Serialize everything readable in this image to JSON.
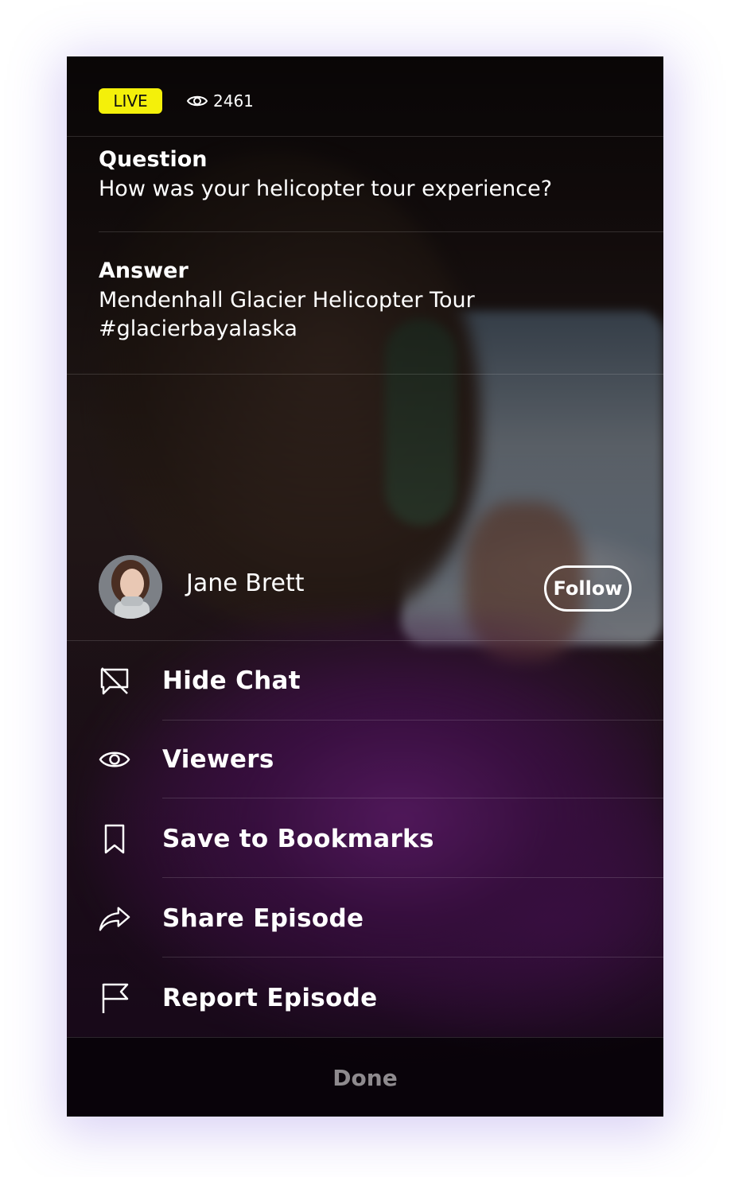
{
  "status": {
    "live_label": "LIVE",
    "viewer_count": "2461"
  },
  "question": {
    "label": "Question",
    "text": "How was your helicopter tour experience?"
  },
  "answer": {
    "label": "Answer",
    "text_line1": "Mendenhall Glacier Helicopter Tour",
    "text_line2": "#glacierbayalaska"
  },
  "host": {
    "name": "Jane Brett",
    "follow_label": "Follow"
  },
  "menu": [
    {
      "label": "Hide Chat",
      "icon": "chat-off-icon"
    },
    {
      "label": "Viewers",
      "icon": "eye-icon"
    },
    {
      "label": "Save to Bookmarks",
      "icon": "bookmark-icon"
    },
    {
      "label": "Share Episode",
      "icon": "share-icon"
    },
    {
      "label": "Report Episode",
      "icon": "flag-icon"
    }
  ],
  "done_label": "Done",
  "colors": {
    "live_badge": "#f4f00a",
    "done_text": "#8e8a8e"
  }
}
